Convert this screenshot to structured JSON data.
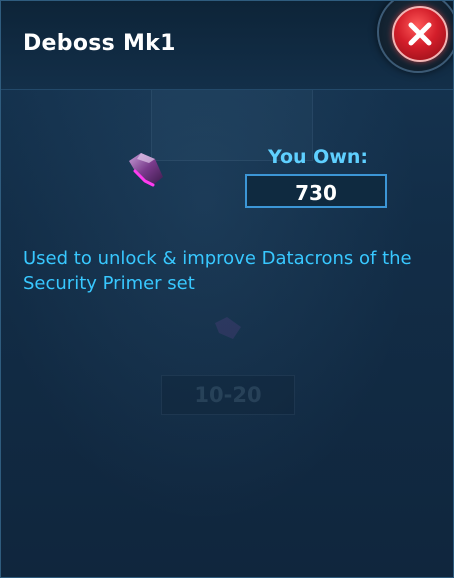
{
  "dialog": {
    "title": "Deboss Mk1",
    "close_icon": "close-x-icon"
  },
  "item": {
    "icon": "purple-shard-icon",
    "own_label": "You Own:",
    "own_value": "730",
    "description": "Used to unlock & improve Datacrons of the Security Primer set"
  },
  "background": {
    "ghost_label": "10-20"
  },
  "colors": {
    "accent_blue": "#38c8ff",
    "close_red": "#d31e2a",
    "panel_bg": "#122d47",
    "item_purple": "#d63bd0"
  }
}
